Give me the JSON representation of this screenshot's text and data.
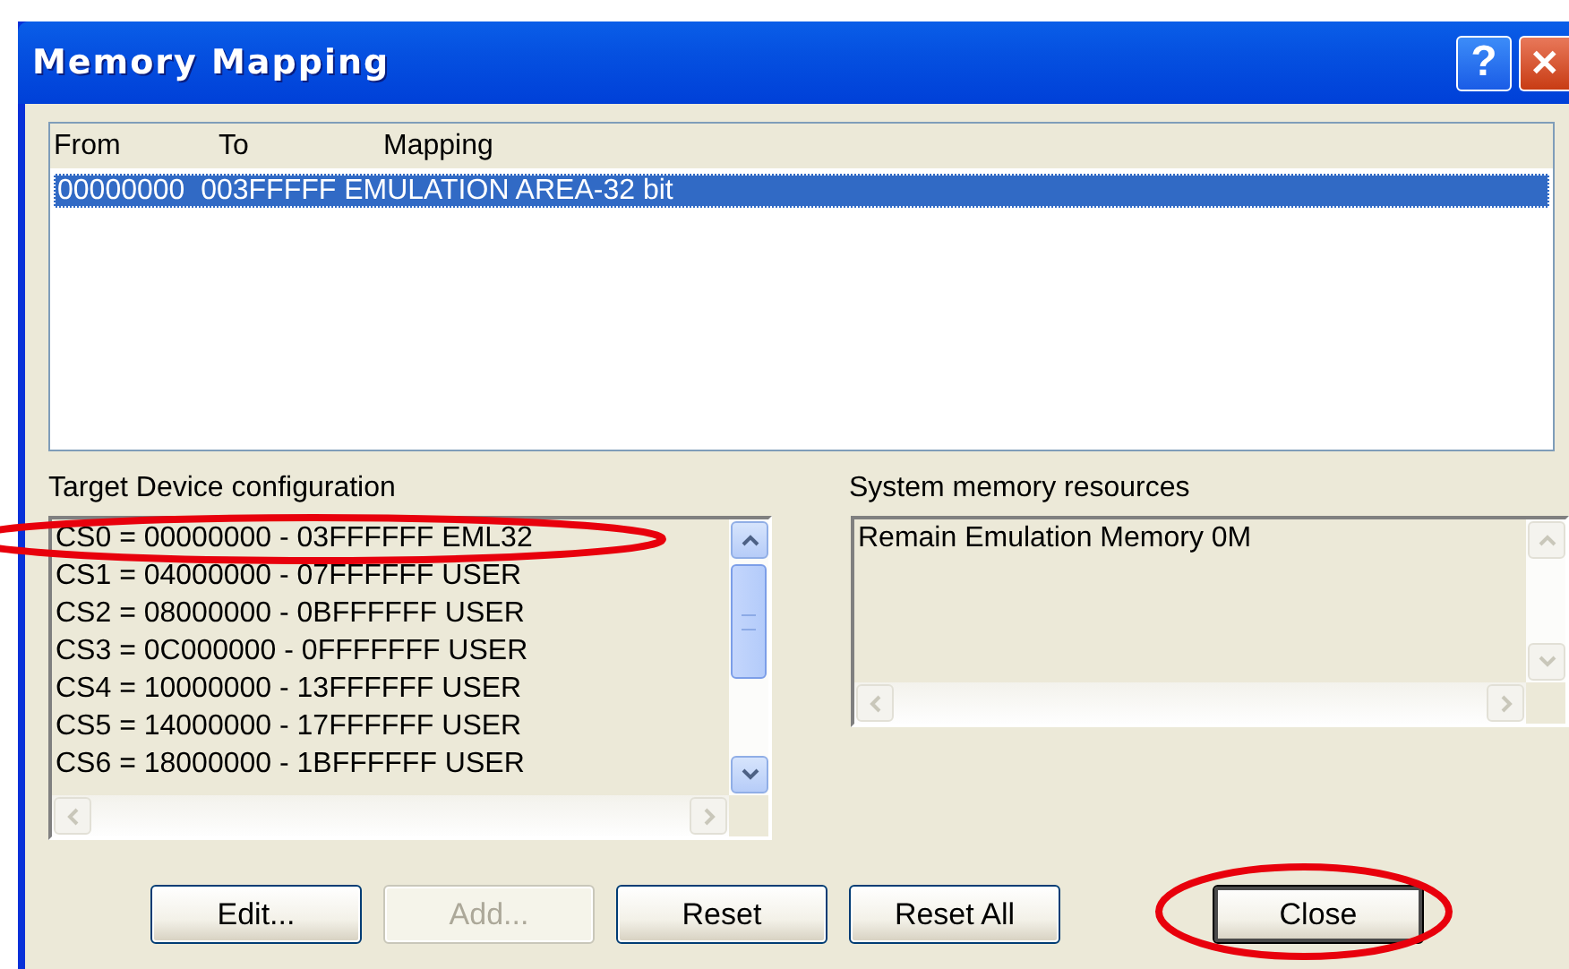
{
  "window": {
    "title": "Memory Mapping",
    "title_buttons": [
      {
        "kind": "help",
        "label": "?"
      },
      {
        "kind": "close",
        "label": "✕"
      }
    ]
  },
  "mapping_list": {
    "columns": [
      "From",
      "To",
      "Mapping"
    ],
    "rows": [
      {
        "text": "00000000  003FFFFF EMULATION AREA-32 bit",
        "selected": true
      }
    ]
  },
  "target_device": {
    "label": "Target Device configuration",
    "lines": [
      "CS0 = 00000000 - 03FFFFFF EML32",
      "CS1 = 04000000 - 07FFFFFF USER",
      "CS2 = 08000000 - 0BFFFFFF USER",
      "CS3 = 0C000000 - 0FFFFFFF USER",
      "CS4 = 10000000 - 13FFFFFF USER",
      "CS5 = 14000000 - 17FFFFFF USER",
      "CS6 = 18000000 - 1BFFFFFF USER"
    ]
  },
  "system_memory": {
    "label": "System memory resources",
    "lines": [
      "Remain Emulation Memory 0M"
    ]
  },
  "buttons": [
    {
      "label": "Edit...",
      "disabled": false,
      "default": false
    },
    {
      "label": "Add...",
      "disabled": true,
      "default": false
    },
    {
      "label": "Reset",
      "disabled": false,
      "default": false
    },
    {
      "label": "Reset All",
      "disabled": false,
      "default": false
    },
    {
      "label": "Close",
      "disabled": false,
      "default": true
    }
  ],
  "annotations": [
    {
      "kind": "ellipse"
    },
    {
      "kind": "ellipse"
    }
  ]
}
